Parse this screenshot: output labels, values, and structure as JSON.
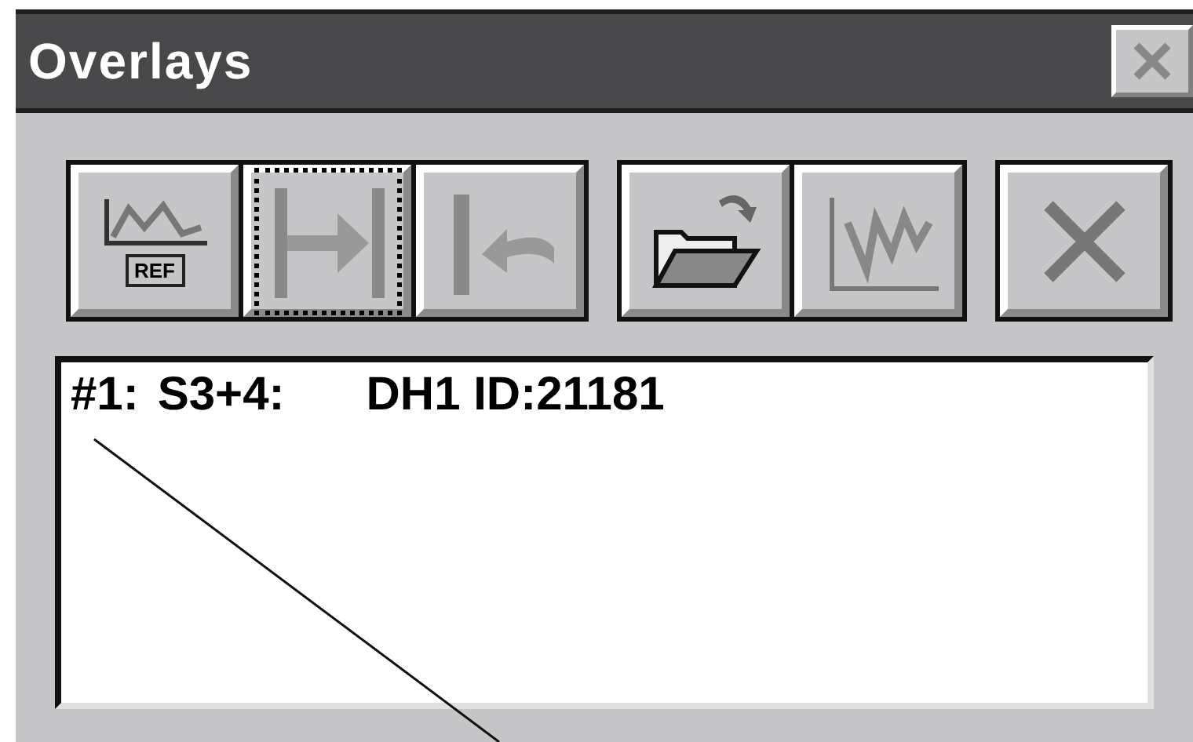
{
  "window": {
    "title": "Overlays"
  },
  "toolbar": {
    "groups": [
      [
        {
          "kind": "reference",
          "label": "REF",
          "focused": false
        },
        {
          "kind": "span",
          "focused": true
        },
        {
          "kind": "undo",
          "focused": false
        }
      ],
      [
        {
          "kind": "open",
          "focused": false
        },
        {
          "kind": "scatter",
          "focused": false
        }
      ],
      [
        {
          "kind": "delete",
          "focused": false
        }
      ]
    ]
  },
  "list": {
    "items": [
      {
        "number": "#1:",
        "source": "S3+4:",
        "detail": "DH1 ID:21181"
      }
    ]
  }
}
